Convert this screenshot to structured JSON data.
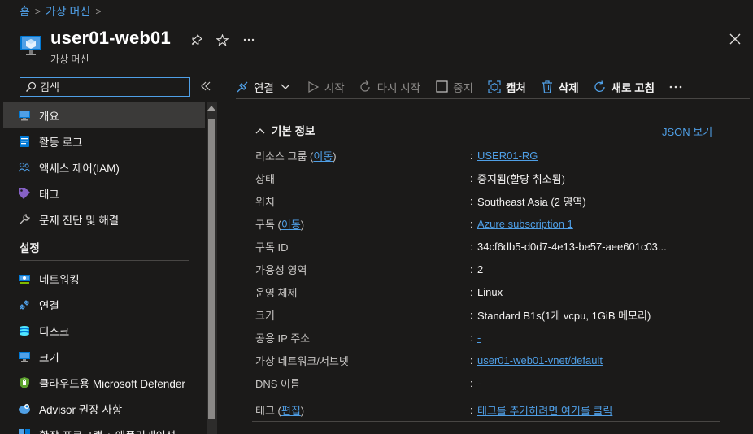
{
  "breadcrumb": {
    "home": "홈",
    "parent": "가상 머신"
  },
  "header": {
    "title": "user01-web01",
    "subtitle": "가상 머신"
  },
  "search": {
    "placeholder": "검색"
  },
  "sidebar": {
    "items": [
      {
        "label": "개요",
        "icon": "monitor-icon"
      },
      {
        "label": "활동 로그",
        "icon": "activity-log-icon"
      },
      {
        "label": "액세스 제어(IAM)",
        "icon": "people-icon"
      },
      {
        "label": "태그",
        "icon": "tag-icon"
      },
      {
        "label": "문제 진단 및 해결",
        "icon": "wrench-icon"
      }
    ],
    "section_label": "설정",
    "settings_items": [
      {
        "label": "네트워킹",
        "icon": "networking-icon"
      },
      {
        "label": "연결",
        "icon": "connect-icon"
      },
      {
        "label": "디스크",
        "icon": "disk-icon"
      },
      {
        "label": "크기",
        "icon": "size-icon"
      },
      {
        "label": "클라우드용 Microsoft Defender",
        "icon": "defender-shield-icon"
      },
      {
        "label": "Advisor 권장 사항",
        "icon": "advisor-icon"
      },
      {
        "label": "확장 프로그램 + 애플리케이션",
        "icon": "extensions-icon"
      }
    ]
  },
  "toolbar": {
    "connect": "연결",
    "start": "시작",
    "restart": "다시 시작",
    "stop": "중지",
    "capture": "캡처",
    "delete": "삭제",
    "refresh": "새로 고침"
  },
  "essentials": {
    "heading": "기본 정보",
    "json_view": "JSON 보기",
    "properties": [
      {
        "label": "리소스 그룹",
        "label_link": "이동",
        "value": "USER01-RG",
        "value_is_link": true
      },
      {
        "label": "상태",
        "value": "중지됨(할당 취소됨)"
      },
      {
        "label": "위치",
        "value": "Southeast Asia (2 영역)"
      },
      {
        "label": "구독",
        "label_link": "이동",
        "value": "Azure subscription 1",
        "value_is_link": true
      },
      {
        "label": "구독 ID",
        "value": "34cf6db5-d0d7-4e13-be57-aee601c03..."
      },
      {
        "label": "가용성 영역",
        "value": "2"
      },
      {
        "label": "운영 체제",
        "value": "Linux"
      },
      {
        "label": "크기",
        "value": "Standard B1s(1개 vcpu, 1GiB 메모리)"
      },
      {
        "label": "공용 IP 주소",
        "value": "-",
        "value_is_link": true
      },
      {
        "label": "가상 네트워크/서브넷",
        "value": "user01-web01-vnet/default",
        "value_is_link": true
      },
      {
        "label": "DNS 이름",
        "value": "-",
        "value_is_link": true
      },
      {
        "label": "태그",
        "label_link": "편집",
        "value": "태그를 추가하려면 여기를 클릭",
        "value_is_link": true
      }
    ]
  },
  "colors": {
    "accent": "#4f9fe6",
    "background": "#1b1a19",
    "selected": "#3b3a39"
  }
}
